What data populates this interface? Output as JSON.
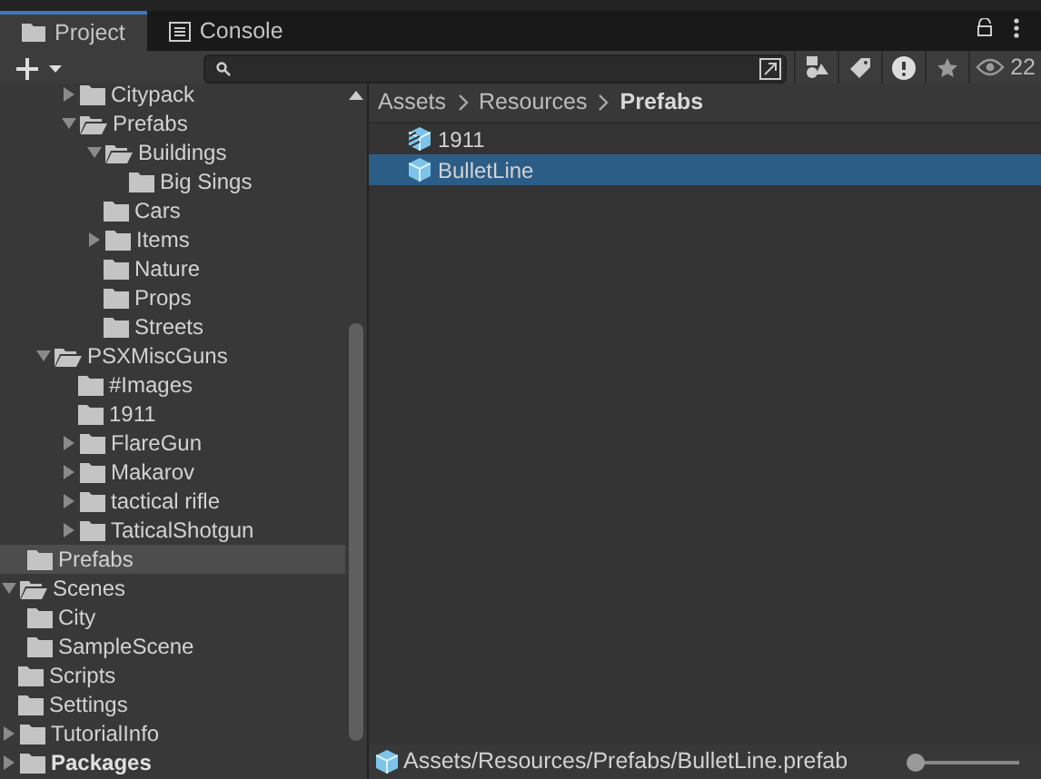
{
  "tabs": [
    {
      "label": "Project",
      "kind": "project",
      "selected": true
    },
    {
      "label": "Console",
      "kind": "console",
      "selected": false
    }
  ],
  "toolbar": {
    "hidden_count": "22"
  },
  "tree": [
    {
      "kind": "hidden",
      "children": [
        {
          "kind": "hidden",
          "children": [
            {
              "kind": "hidden",
              "children": [
                {
                  "kind": "hidden",
                  "children": [
                    {
                      "label": "Citypack",
                      "kind": "folder",
                      "expanded": false,
                      "selected": false
                    },
                    {
                      "label": "Prefabs",
                      "kind": "folder",
                      "expanded": true,
                      "selected": false,
                      "children": [
                        {
                          "label": "Buildings",
                          "kind": "folder",
                          "expanded": true,
                          "selected": false,
                          "children": [
                            {
                              "label": "Big Sings",
                              "kind": "folder",
                              "selected": false
                            }
                          ]
                        },
                        {
                          "label": "Cars",
                          "kind": "folder",
                          "selected": false
                        },
                        {
                          "label": "Items",
                          "kind": "folder",
                          "expanded": false,
                          "selected": false
                        },
                        {
                          "label": "Nature",
                          "kind": "folder",
                          "selected": false
                        },
                        {
                          "label": "Props",
                          "kind": "folder",
                          "selected": false
                        },
                        {
                          "label": "Streets",
                          "kind": "folder",
                          "selected": false
                        }
                      ]
                    }
                  ]
                },
                {
                  "label": "PSXMiscGuns",
                  "kind": "folder",
                  "expanded": true,
                  "selected": false,
                  "children": [
                    {
                      "label": "#Images",
                      "kind": "folder",
                      "selected": false
                    },
                    {
                      "label": "1911",
                      "kind": "folder",
                      "selected": false
                    },
                    {
                      "label": "FlareGun",
                      "kind": "folder",
                      "expanded": false,
                      "selected": false
                    },
                    {
                      "label": "Makarov",
                      "kind": "folder",
                      "expanded": false,
                      "selected": false
                    },
                    {
                      "label": "tactical rifle",
                      "kind": "folder",
                      "expanded": false,
                      "selected": false
                    },
                    {
                      "label": "TaticalShotgun",
                      "kind": "folder",
                      "expanded": false,
                      "selected": false
                    }
                  ]
                }
              ]
            },
            {
              "label": "Prefabs",
              "kind": "folder",
              "selected": true
            }
          ]
        },
        {
          "label": "Scenes",
          "kind": "folder",
          "expanded": true,
          "selected": false,
          "children": [
            {
              "label": "City",
              "kind": "folder",
              "selected": false
            },
            {
              "label": "SampleScene",
              "kind": "folder",
              "selected": false
            }
          ]
        },
        {
          "label": "Scripts",
          "kind": "folder",
          "selected": false
        },
        {
          "label": "Settings",
          "kind": "folder",
          "selected": false
        },
        {
          "label": "TutorialInfo",
          "kind": "folder",
          "expanded": false,
          "selected": false
        }
      ]
    },
    {
      "label": "Packages",
      "kind": "root",
      "expanded": false,
      "selected": false
    }
  ],
  "breadcrumb": [
    "Assets",
    "Resources",
    "Prefabs"
  ],
  "assets": [
    {
      "label": "1911",
      "kind": "variant",
      "selected": false
    },
    {
      "label": "BulletLine",
      "kind": "prefab",
      "selected": true
    }
  ],
  "footer": {
    "path": "Assets/Resources/Prefabs/BulletLine.prefab",
    "zoom": {
      "level": 0.05
    }
  }
}
